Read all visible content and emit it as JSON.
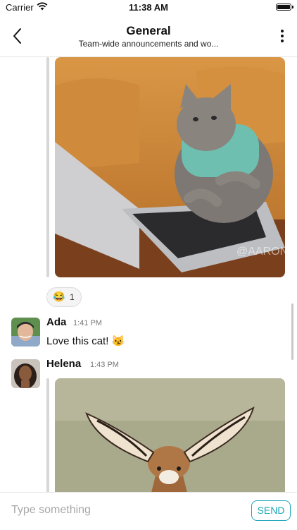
{
  "status_bar": {
    "carrier": "Carrier",
    "time": "11:38 AM"
  },
  "header": {
    "title": "General",
    "subtitle": "Team-wide announcements and wo...",
    "back_icon": "chevron-left-icon",
    "more_icon": "vertical-ellipsis-icon"
  },
  "messages": [
    {
      "attachment": "cat typing on laptop gif",
      "watermark": "@AARON",
      "reaction": {
        "emoji": "😂",
        "count": "1"
      }
    },
    {
      "author": "Ada",
      "time": "1:41 PM",
      "text": "Love this cat! 😼"
    },
    {
      "author": "Helena",
      "time": "1:43 PM",
      "attachment": "antelope with large ears gif"
    }
  ],
  "composer": {
    "placeholder": "Type something",
    "send_label": "SEND"
  },
  "colors": {
    "accent": "#1ea7b8",
    "divider": "#e4e4e4"
  }
}
